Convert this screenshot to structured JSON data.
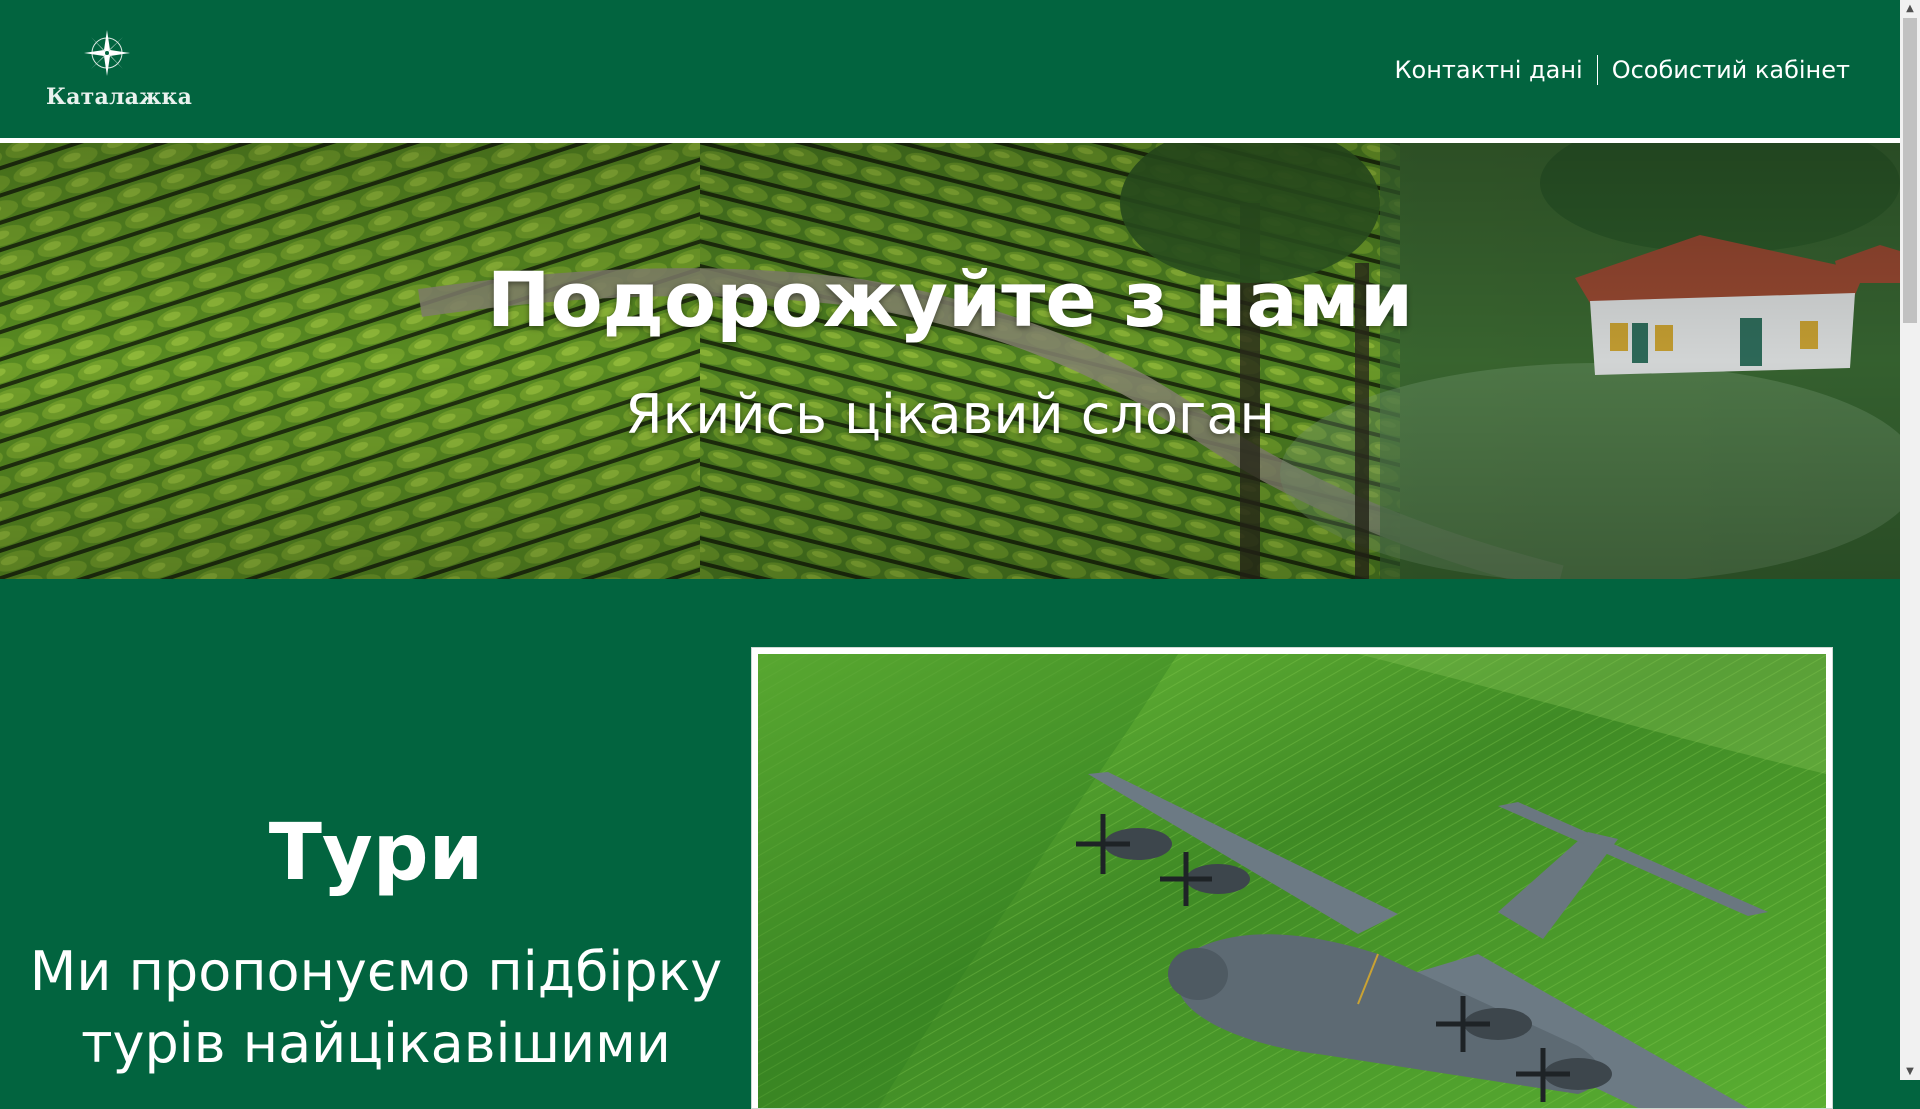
{
  "brand": {
    "name": "Каталажка",
    "logo_icon": "compass-rose-icon"
  },
  "nav": {
    "contacts": "Контактні дані",
    "account": "Особистий кабінет"
  },
  "hero": {
    "title": "Подорожуйте з нами",
    "slogan": "Якийсь цікавий слоган"
  },
  "tours": {
    "title": "Тури",
    "text_line1": "Ми пропонуємо підбірку",
    "text_line2": "турів найцікавішими"
  },
  "colors": {
    "brand_green": "#02643f",
    "white": "#ffffff"
  }
}
